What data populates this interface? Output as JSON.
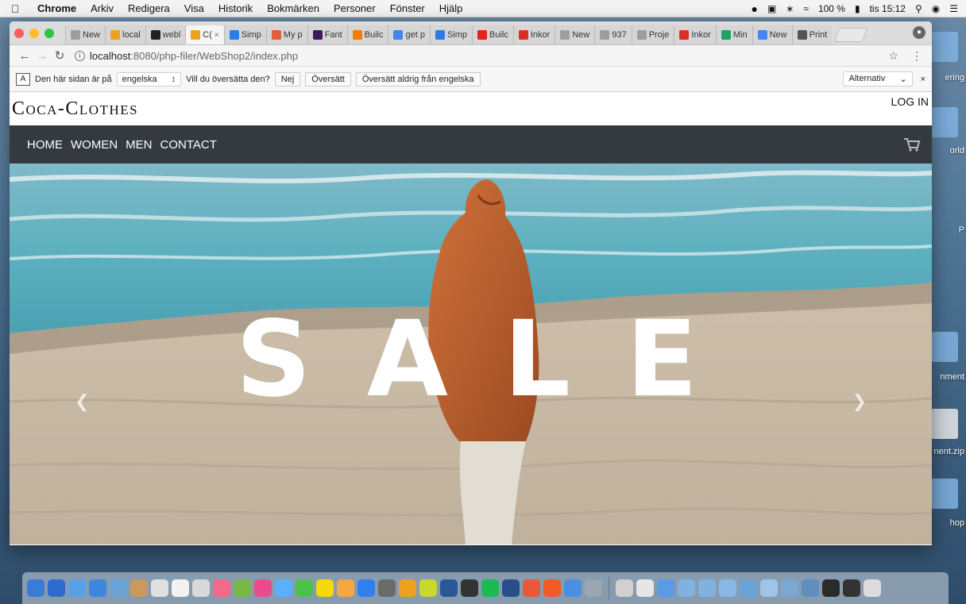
{
  "menubar": {
    "app_name": "Chrome",
    "items": [
      "Arkiv",
      "Redigera",
      "Visa",
      "Historik",
      "Bokmärken",
      "Personer",
      "Fönster",
      "Hjälp"
    ],
    "battery": "100 %",
    "clock": "tis 15:12"
  },
  "desktop": {
    "labels": [
      "ering",
      "orld",
      "P",
      "nment",
      "nent.zip",
      "hop"
    ]
  },
  "tabs": [
    {
      "label": "New",
      "color": "#9e9e9e"
    },
    {
      "label": "local",
      "color": "#f0a020"
    },
    {
      "label": "webl",
      "color": "#222222"
    },
    {
      "label": "C(",
      "color": "#f0a020",
      "active": true
    },
    {
      "label": "Simp",
      "color": "#2b7de9"
    },
    {
      "label": "My p",
      "color": "#e25d3c"
    },
    {
      "label": "Fant",
      "color": "#3d195b"
    },
    {
      "label": "Builc",
      "color": "#f57c00"
    },
    {
      "label": "get p",
      "color": "#4285f4"
    },
    {
      "label": "Simp",
      "color": "#2b7de9"
    },
    {
      "label": "Builc",
      "color": "#e62117"
    },
    {
      "label": "Inkor",
      "color": "#d93025"
    },
    {
      "label": "New",
      "color": "#9e9e9e"
    },
    {
      "label": "937",
      "color": "#9e9e9e"
    },
    {
      "label": "Proje",
      "color": "#9e9e9e"
    },
    {
      "label": "Inkor",
      "color": "#d93025"
    },
    {
      "label": "Min",
      "color": "#1da462"
    },
    {
      "label": "New",
      "color": "#4285f4"
    },
    {
      "label": "Print",
      "color": "#555555"
    }
  ],
  "toolbar": {
    "url_host": "localhost",
    "url_path": ":8080/php-filer/WebShop2/index.php"
  },
  "translate": {
    "prefix": "Den här sidan är på",
    "language": "engelska",
    "question": "Vill du översätta den?",
    "no": "Nej",
    "translate": "Översätt",
    "never": "Översätt aldrig från engelska",
    "options": "Alternativ"
  },
  "site": {
    "brand": "Coca-Clothes",
    "login": "LOG IN",
    "nav": [
      "HOME",
      "WOMEN",
      "MEN",
      "CONTACT"
    ],
    "hero_title": "SALE"
  },
  "dock": {
    "colors": [
      "#3a7bd5",
      "#2e6bd0",
      "#5aa0e6",
      "#3f86e0",
      "#6aa3d8",
      "#c99a5b",
      "#e0e0e0",
      "#f2f2f2",
      "#d9d9d9",
      "#f06a8a",
      "#76b947",
      "#e84c8b",
      "#58b0ff",
      "#4cc24c",
      "#f5d90a",
      "#f4a742",
      "#2f80ed",
      "#6b6b6b",
      "#f0a020",
      "#c8d830",
      "#2b5797",
      "#333333",
      "#1db954",
      "#2a4e8a",
      "#e9583b",
      "#f15a24",
      "#4a90e2",
      "#9aa7b3",
      "#d0d0d0",
      "#e6e6e6",
      "#5a9ae6",
      "#7fb2e0",
      "#7fb2e0",
      "#8ab8e6",
      "#6aa3d8",
      "#9ec4ea",
      "#7ba7d4",
      "#5f8fbe",
      "#2b2b2b",
      "#333333",
      "#dcdcdc"
    ]
  }
}
